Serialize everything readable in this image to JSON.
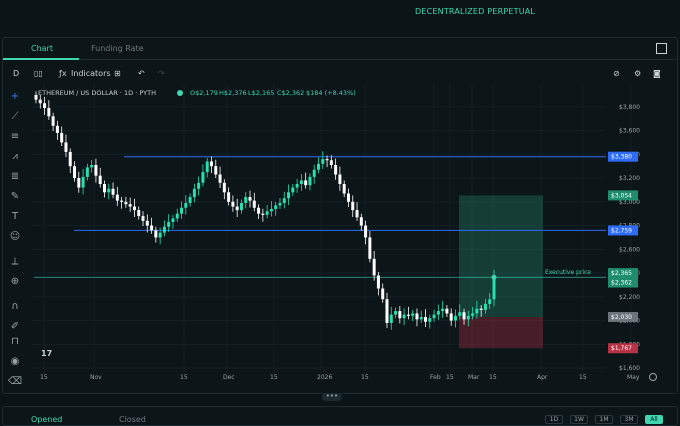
{
  "header": {
    "title": "DECENTRALIZED PERPETUAL"
  },
  "tabs": [
    {
      "label": "Chart"
    },
    {
      "label": "Funding Rate"
    }
  ],
  "toolbar": {
    "interval": "D",
    "indicators": "Indicators"
  },
  "legend": {
    "symbol": "ETHEREUM / US DOLLAR · 1D · PYTH",
    "o": "O$2,179",
    "h": "H$2,376",
    "l": "L$2,165",
    "c": "C$2,362",
    "chg": "$184 (+8.43%)"
  },
  "price_labels": {
    "l3380": "$3,380",
    "l3054": "$3,054",
    "l2759": "$2,759",
    "l2365": "$2,365",
    "l2362": "$2,362",
    "l2030": "$2,030",
    "l1767": "$1,767",
    "exec": "Executive price"
  },
  "bottom_tabs": [
    {
      "label": "Opened"
    },
    {
      "label": "Closed"
    }
  ],
  "ranges": [
    "1D",
    "1W",
    "1M",
    "3M",
    "All"
  ],
  "colors": {
    "accent": "#3fd6b0",
    "up": "#26e0b0",
    "down": "#ffffff",
    "line": "#2f6cf5",
    "sell": "#b83246"
  },
  "chart_data": {
    "type": "candlestick",
    "y_ticks": [
      "$3,800",
      "$3,600",
      "$3,400",
      "$3,200",
      "$3,000",
      "$2,800",
      "$2,600",
      "$2,400",
      "$2,200",
      "$2,000",
      "$1,800",
      "$1,600"
    ],
    "x_ticks": [
      "15",
      "Nov",
      "15",
      "Dec",
      "15",
      "2026",
      "15",
      "Feb",
      "15",
      "Mar",
      "15",
      "Apr",
      "15",
      "May"
    ],
    "ylim": [
      1550,
      3950
    ],
    "horizontal_lines": [
      3380,
      2759
    ],
    "executive_price": 2365,
    "take_profit": 3054,
    "entry": 2030,
    "stop_loss": 1767,
    "close": [
      3860,
      3830,
      3790,
      3720,
      3640,
      3580,
      3500,
      3420,
      3300,
      3200,
      3120,
      3210,
      3290,
      3310,
      3220,
      3150,
      3080,
      3110,
      3060,
      3010,
      3000,
      2980,
      2960,
      2930,
      2880,
      2840,
      2800,
      2760,
      2700,
      2740,
      2790,
      2830,
      2860,
      2900,
      2950,
      2990,
      3040,
      3110,
      3160,
      3250,
      3340,
      3300,
      3230,
      3160,
      3080,
      3000,
      2960,
      2930,
      2990,
      3040,
      3010,
      2950,
      2900,
      2890,
      2920,
      2940,
      2970,
      2990,
      3030,
      3080,
      3120,
      3150,
      3180,
      3140,
      3210,
      3270,
      3320,
      3360,
      3350,
      3310,
      3230,
      3150,
      3070,
      3000,
      2930,
      2870,
      2800,
      2700,
      2520,
      2380,
      2270,
      2180,
      1980,
      2050,
      2080,
      2020,
      2050,
      2040,
      2060,
      2010,
      2030,
      1990,
      2020,
      2050,
      2080,
      2100,
      2060,
      2000,
      2040,
      2070,
      2010,
      2040,
      2060,
      2100,
      2090,
      2140,
      2179,
      2362
    ]
  }
}
